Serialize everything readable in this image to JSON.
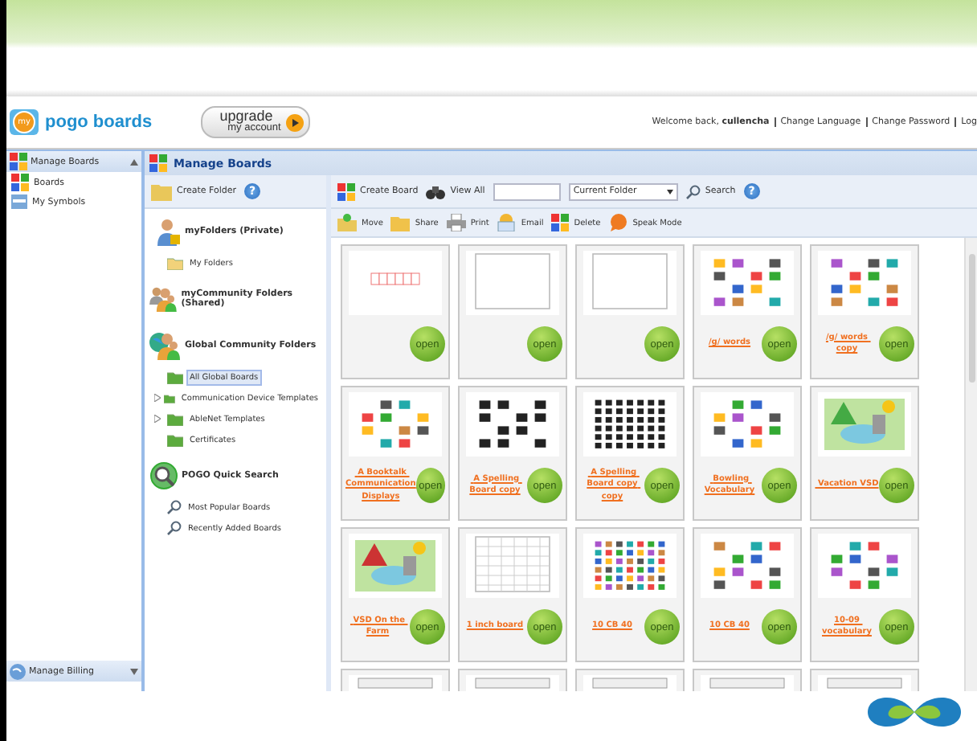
{
  "header": {
    "logo": "pogo boards",
    "logo_badge": "my",
    "upgrade": {
      "big": "upgrade",
      "small": "my account"
    },
    "welcome": "Welcome back, **cullencha**",
    "links": [
      "Change Language",
      "Change Password",
      "Log"
    ]
  },
  "nav": {
    "title": "Manage Boards",
    "items": [
      {
        "label": "Boards"
      },
      {
        "label": "My Symbols"
      }
    ],
    "footer": "Manage Billing"
  },
  "page_title": "Manage Boards",
  "folders": {
    "create": "Create Folder",
    "help": "?",
    "sections": [
      {
        "title": "myFolders (Private)",
        "items": [
          {
            "label": "My Folders",
            "selected": false,
            "has_children": false
          }
        ]
      },
      {
        "title": "myCommunity Folders (Shared)"
      },
      {
        "title": "Global Community Folders",
        "items": [
          {
            "label": "All Global Boards",
            "selected": true,
            "has_children": false
          },
          {
            "label": "Communication Device Templates",
            "selected": false,
            "has_children": true
          },
          {
            "label": "AbleNet Templates",
            "selected": false,
            "has_children": true
          },
          {
            "label": "Certificates",
            "selected": false,
            "has_children": false
          }
        ]
      },
      {
        "title": "POGO Quick Search",
        "items": [
          {
            "label": "Most Popular Boards",
            "selected": false,
            "has_children": false
          },
          {
            "label": "Recently Added Boards",
            "selected": false,
            "has_children": false
          }
        ]
      }
    ]
  },
  "toolbar": {
    "create": "Create Board",
    "view_all": "View All",
    "scope": "Current Folder",
    "search": "Search",
    "help": "?"
  },
  "actions": [
    "Move",
    "Share",
    "Print",
    "Email",
    "Delete",
    "Speak Mode"
  ],
  "boards": [
    {
      "kind": "board",
      "button": "open"
    },
    {
      "kind": "board",
      "button": "open"
    },
    {
      "kind": "board",
      "button": "open"
    },
    {
      "kind": "board",
      "title": "/g/ words",
      "button": "open"
    },
    {
      "kind": "board",
      "title": "/g/ words copy",
      "button": "open"
    },
    {
      "kind": "board",
      "title": " A Booktalk Communication Displays",
      "button": "open"
    },
    {
      "kind": "board",
      "title": " A Spelling Board copy",
      "button": "open"
    },
    {
      "kind": "board",
      "title": " A Spelling Board copy copy",
      "button": "open"
    },
    {
      "kind": "board",
      "title": " Bowling Vocabulary",
      "button": "open"
    },
    {
      "kind": "board",
      "title": " Vacation VSD",
      "button": "open"
    },
    {
      "kind": "board",
      "title": " VSD On the Farm",
      "button": "open"
    },
    {
      "kind": "board",
      "title": "1 inch board",
      "button": "open"
    },
    {
      "kind": "board",
      "title": "10 CB 40",
      "button": "open"
    },
    {
      "kind": "board",
      "title": "10 CB 40",
      "button": "open"
    },
    {
      "kind": "board",
      "title": "10-09 vocabulary",
      "button": "open"
    },
    {
      "kind": "partial"
    },
    {
      "kind": "partial"
    },
    {
      "kind": "partial"
    },
    {
      "kind": "partial"
    },
    {
      "kind": "partial"
    }
  ]
}
